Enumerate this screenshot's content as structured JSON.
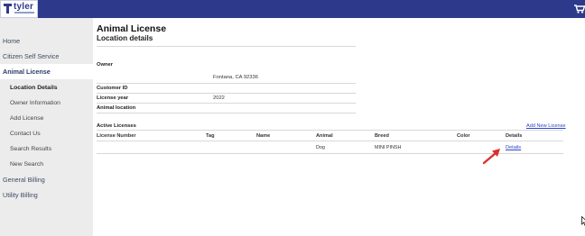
{
  "header": {
    "logo_text": "tyler",
    "logo_subtext": "technologies",
    "cart_icon": "shopping-cart-icon",
    "bar_color": "#2d3a8c"
  },
  "sidebar": {
    "items": [
      {
        "label": "Home"
      },
      {
        "label": "Citizen Self Service"
      },
      {
        "label": "Animal License"
      },
      {
        "label": "Location Details"
      },
      {
        "label": "Owner Information"
      },
      {
        "label": "Add License"
      },
      {
        "label": "Contact Us"
      },
      {
        "label": "Search Results"
      },
      {
        "label": "New Search"
      },
      {
        "label": "General Billing"
      },
      {
        "label": "Utility Billing"
      }
    ]
  },
  "main": {
    "title": "Animal License",
    "subtitle": "Location details",
    "owner_label": "Owner",
    "owner_address": "Fontana, CA 92336",
    "customer_id_label": "Customer ID",
    "license_year_label": "License year",
    "license_year_value": "2022",
    "animal_location_label": "Animal location",
    "active_licenses_label": "Active Licenses",
    "add_new_license_label": "Add New License",
    "table": {
      "headers": [
        "License Number",
        "Tag",
        "Name",
        "Animal",
        "Breed",
        "Color",
        "Details"
      ],
      "rows": [
        {
          "license_number": "",
          "tag": "",
          "name": "",
          "animal": "Dog",
          "breed": "MINI PINSH",
          "color": "",
          "details": "Details"
        }
      ]
    }
  },
  "colors": {
    "link": "#2b46c8",
    "annotation_arrow": "#d9302b"
  }
}
